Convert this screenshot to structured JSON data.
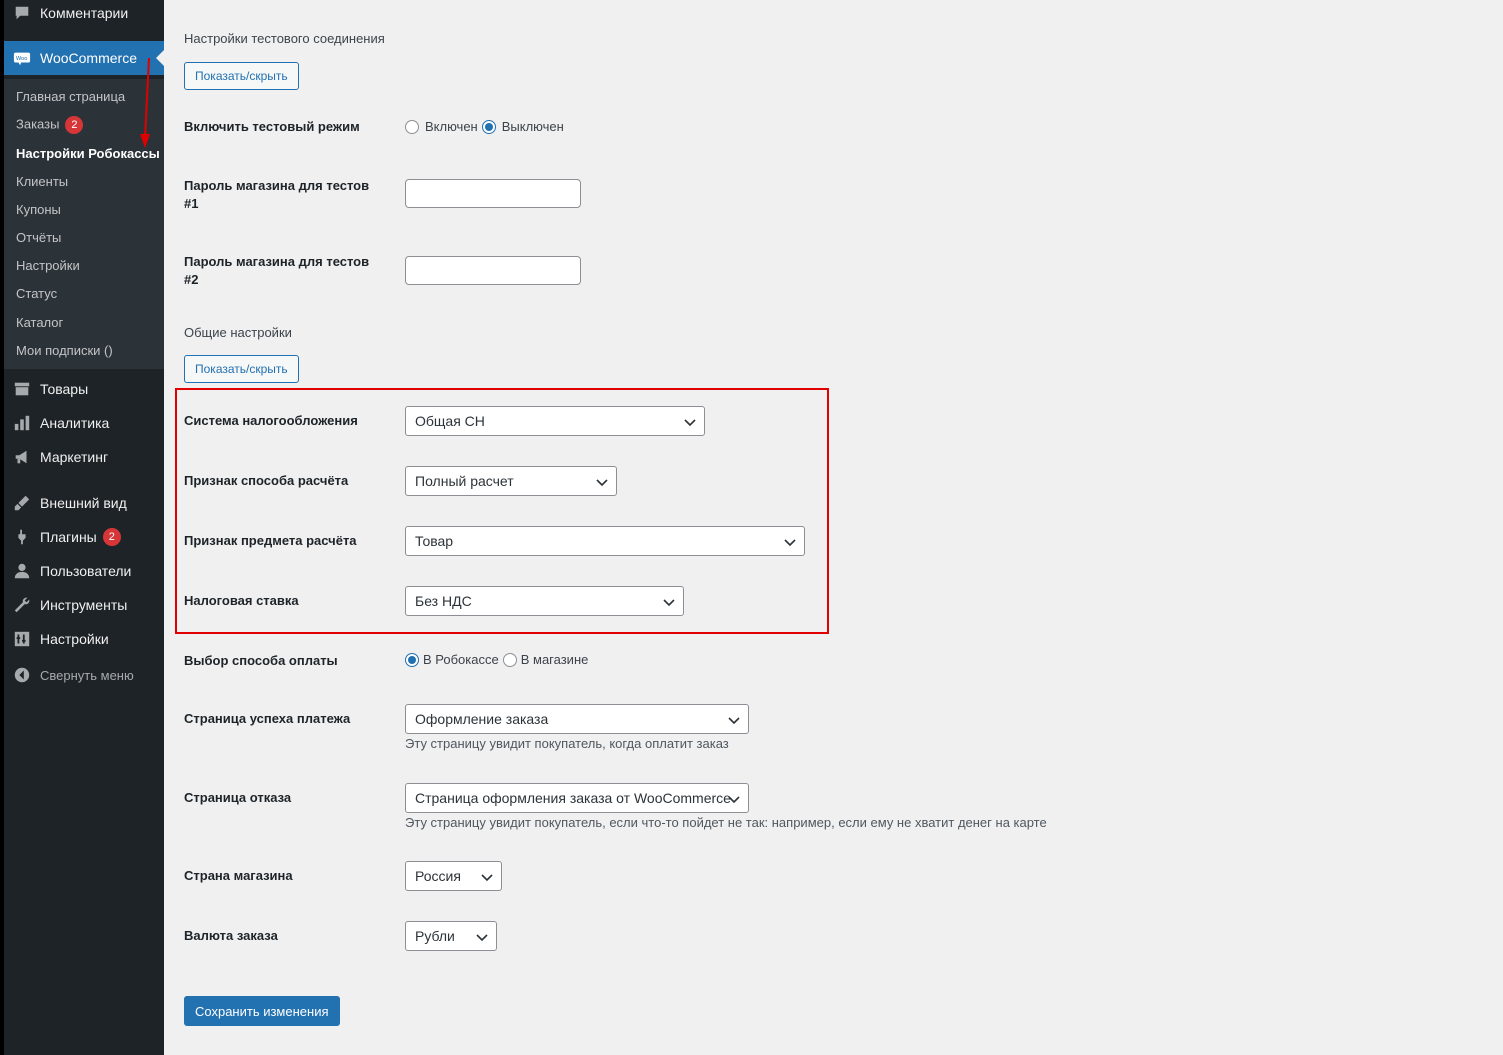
{
  "sidebar": {
    "top_items": [
      {
        "label": "Комментарии",
        "icon": "comment-icon"
      },
      {
        "label": "WooCommerce",
        "icon": "woocommerce-icon"
      }
    ],
    "woo_submenu": [
      {
        "label": "Главная страница"
      },
      {
        "label": "Заказы",
        "badge": "2"
      },
      {
        "label": "Настройки Робокассы"
      },
      {
        "label": "Клиенты"
      },
      {
        "label": "Купоны"
      },
      {
        "label": "Отчёты"
      },
      {
        "label": "Настройки"
      },
      {
        "label": "Статус"
      },
      {
        "label": "Каталог"
      },
      {
        "label": "Мои подписки ()"
      }
    ],
    "bottom_items": [
      {
        "label": "Товары",
        "icon": "archive-icon"
      },
      {
        "label": "Аналитика",
        "icon": "bar-chart-icon"
      },
      {
        "label": "Маркетинг",
        "icon": "megaphone-icon"
      },
      {
        "label": "Внешний вид",
        "icon": "brush-icon"
      },
      {
        "label": "Плагины",
        "icon": "plugin-icon",
        "badge": "2"
      },
      {
        "label": "Пользователи",
        "icon": "user-icon"
      },
      {
        "label": "Инструменты",
        "icon": "wrench-icon"
      },
      {
        "label": "Настройки",
        "icon": "settings-icon"
      }
    ],
    "collapse_label": "Свернуть меню"
  },
  "test_section": {
    "title": "Настройки тестового соединения",
    "toggle_label": "Показать/скрыть",
    "test_mode": {
      "label": "Включить тестовый режим",
      "options": [
        {
          "label": "Включен",
          "checked": false
        },
        {
          "label": "Выключен",
          "checked": true
        }
      ]
    },
    "password1": {
      "label": "Пароль магазина для тестов #1",
      "value": ""
    },
    "password2": {
      "label": "Пароль магазина для тестов #2",
      "value": ""
    }
  },
  "general_section": {
    "title": "Общие настройки",
    "toggle_label": "Показать/скрыть",
    "tax_system": {
      "label": "Система налогообложения",
      "value": "Общая СН"
    },
    "payment_method": {
      "label": "Признак способа расчёта",
      "value": "Полный расчет"
    },
    "payment_object": {
      "label": "Признак предмета расчёта",
      "value": "Товар"
    },
    "tax_rate": {
      "label": "Налоговая ставка",
      "value": "Без НДС"
    },
    "payment_choice": {
      "label": "Выбор способа оплаты",
      "options": [
        {
          "label": "В Робокассе",
          "checked": true
        },
        {
          "label": "В магазине",
          "checked": false
        }
      ]
    },
    "success_page": {
      "label": "Страница успеха платежа",
      "value": "Оформление заказа",
      "help": "Эту страницу увидит покупатель, когда оплатит заказ"
    },
    "fail_page": {
      "label": "Страница отказа",
      "value": "Страница оформления заказа от WooCommerce",
      "help": "Эту страницу увидит покупатель, если что-то пойдет не так: например, если ему не хватит денег на карте"
    },
    "country": {
      "label": "Страна магазина",
      "value": "Россия"
    },
    "currency": {
      "label": "Валюта заказа",
      "value": "Рубли"
    }
  },
  "save_label": "Сохранить изменения",
  "colors": {
    "accent": "#2271b1",
    "sidebar": "#1d2327",
    "highlight": "#e00000",
    "badge": "#d63638"
  }
}
